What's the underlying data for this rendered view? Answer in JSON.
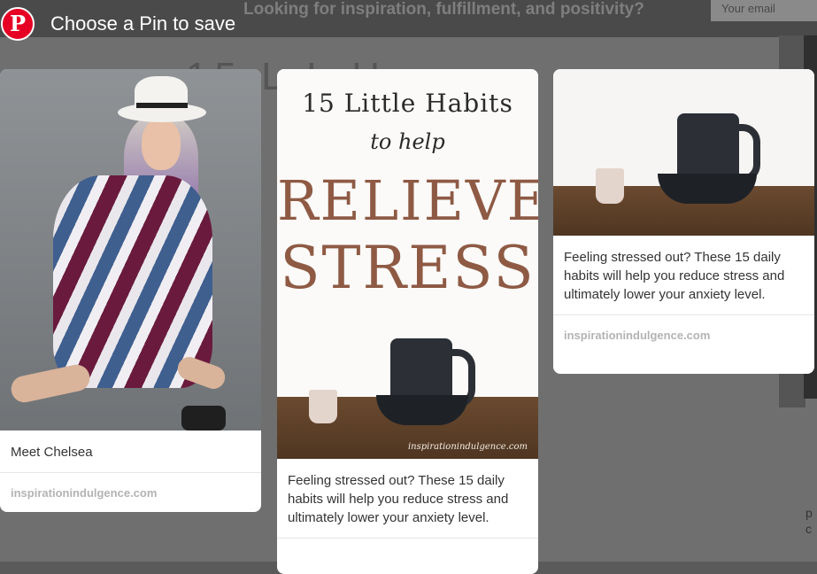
{
  "background_page": {
    "headline": "Looking for inspiration, fulfillment, and positivity?",
    "email_placeholder": "Your email"
  },
  "header": {
    "logo_glyph": "P",
    "title": "Choose a Pin to save"
  },
  "pins": [
    {
      "image": "photo-woman-in-hat",
      "description": "Meet Chelsea",
      "source": "inspirationindulgence.com"
    },
    {
      "image": "graphic-relieve-stress",
      "graphic_text": {
        "line1": "15 Little Habits",
        "line2": "to help",
        "line3": "RELIEVE",
        "line4": "STRESS",
        "watermark": "inspirationindulgence.com"
      },
      "description": "Feeling stressed out? These 15 daily habits will help you reduce stress and ultimately lower your anxiety level."
    },
    {
      "image": "photo-pitcher-and-cup",
      "description": "Feeling stressed out? These 15 daily habits will help you reduce stress and ultimately lower your anxiety level.",
      "source": "inspirationindulgence.com"
    }
  ],
  "colors": {
    "brand": "#e60023",
    "overlay": "#5a5a5a",
    "graphic_accent": "#8e5a44"
  }
}
